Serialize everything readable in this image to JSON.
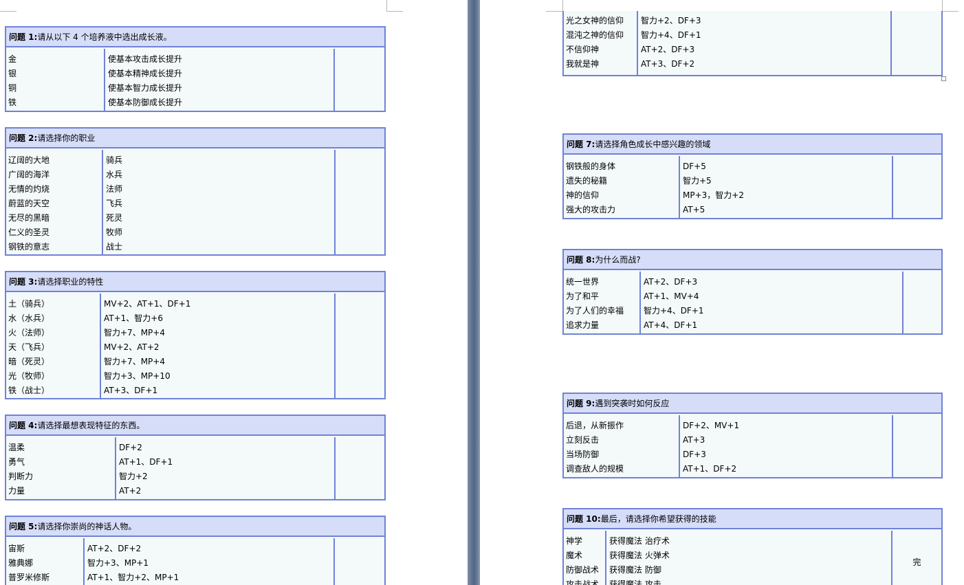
{
  "questions": [
    {
      "label": "问题 1:",
      "text": "请从以下 4 个培养液中选出成长液。",
      "rows": [
        [
          "金",
          "使基本攻击成长提升"
        ],
        [
          "银",
          "使基本精神成长提升"
        ],
        [
          "铜",
          "使基本智力成长提升"
        ],
        [
          "铁",
          "使基本防御成长提升"
        ]
      ]
    },
    {
      "label": "问题 2:",
      "text": "请选择你的职业",
      "rows": [
        [
          "辽阔的大地",
          "骑兵"
        ],
        [
          "广阔的海洋",
          "水兵"
        ],
        [
          "无情的灼烧",
          "法师"
        ],
        [
          "蔚蓝的天空",
          "飞兵"
        ],
        [
          "无尽的黑暗",
          "死灵"
        ],
        [
          "仁义的圣灵",
          "牧师"
        ],
        [
          "钢铁的意志",
          "战士"
        ]
      ]
    },
    {
      "label": "问题 3:",
      "text": "请选择职业的特性",
      "rows": [
        [
          "土（骑兵）",
          "MV+2、AT+1、DF+1"
        ],
        [
          "水（水兵）",
          "AT+1、智力+6"
        ],
        [
          "火（法师）",
          "智力+7、MP+4"
        ],
        [
          "天（飞兵）",
          "MV+2、AT+2"
        ],
        [
          "暗（死灵）",
          "智力+7、MP+4"
        ],
        [
          "光（牧师）",
          "智力+3、MP+10"
        ],
        [
          "铁（战士）",
          "AT+3、DF+1"
        ]
      ]
    },
    {
      "label": "问题 4:",
      "text": "请选择最想表现特征的东西。",
      "rows": [
        [
          "温柔",
          "DF+2"
        ],
        [
          "勇气",
          "AT+1、DF+1"
        ],
        [
          "判断力",
          "智力+2"
        ],
        [
          "力量",
          "AT+2"
        ]
      ]
    },
    {
      "label": "问题 5:",
      "text": "请选择你崇尚的神话人物。",
      "rows": [
        [
          "宙斯",
          "AT+2、DF+2"
        ],
        [
          "雅典娜",
          "智力+3、MP+1"
        ],
        [
          "普罗米修斯",
          "AT+1、智力+2、MP+1"
        ]
      ]
    },
    {
      "rows": [
        [
          "光之女神的信仰",
          "智力+2、DF+3"
        ],
        [
          "混沌之神的信仰",
          "智力+4、DF+1"
        ],
        [
          "不信仰神",
          "AT+2、DF+3"
        ],
        [
          "我就是神",
          "AT+3、DF+2"
        ]
      ]
    },
    {
      "label": "问题 7:",
      "text": "请选择角色成长中感兴趣的领域",
      "rows": [
        [
          "钢铁般的身体",
          "DF+5"
        ],
        [
          "遗失的秘籍",
          "智力+5"
        ],
        [
          "神的信仰",
          "MP+3，智力+2"
        ],
        [
          "强大的攻击力",
          "AT+5"
        ]
      ]
    },
    {
      "label": "问题 8:",
      "text": "为什么而战?",
      "rows": [
        [
          "统一世界",
          "AT+2、DF+3"
        ],
        [
          "为了和平",
          "AT+1、MV+4"
        ],
        [
          "为了人们的幸福",
          "智力+4、DF+1"
        ],
        [
          "追求力量",
          "AT+4、DF+1"
        ]
      ]
    },
    {
      "label": "问题 9:",
      "text": "遇到突袭时如何反应",
      "rows": [
        [
          "后退，从新振作",
          "DF+2、MV+1"
        ],
        [
          "立刻反击",
          "AT+3"
        ],
        [
          "当场防御",
          "DF+3"
        ],
        [
          "调查敌人的规模",
          "AT+1、DF+2"
        ]
      ]
    },
    {
      "label": "问题 10:",
      "text": "最后，请选择你希望获得的技能",
      "rows": [
        [
          "神学",
          "获得魔法 治疗术"
        ],
        [
          "魔术",
          "获得魔法 火弹术"
        ],
        [
          "防御战术",
          "获得魔法 防御"
        ],
        [
          "攻击战术",
          "获得魔法 攻击"
        ]
      ],
      "note": "完"
    }
  ]
}
